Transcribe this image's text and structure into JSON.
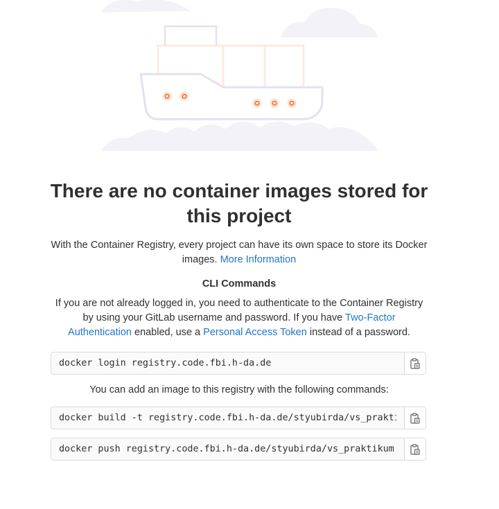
{
  "empty_state": {
    "title": "There are no container images stored for this project",
    "description": "With the Container Registry, every project can have its own space to store its Docker images.",
    "more_info_link": "More Information",
    "cli_heading": "CLI Commands",
    "login_text_1": "If you are not already logged in, you need to authenticate to the Container Registry by using your GitLab username and password. If you have",
    "two_factor_link": "Two-Factor Authentication",
    "login_text_2": "enabled, use a",
    "pat_link": "Personal Access Token",
    "login_text_3": "instead of a password.",
    "add_image_text": "You can add an image to this registry with the following commands:"
  },
  "commands": {
    "login": "docker login registry.code.fbi.h-da.de",
    "build": "docker build -t registry.code.fbi.h-da.de/styubirda/vs_praktikum .",
    "push": "docker push registry.code.fbi.h-da.de/styubirda/vs_praktikum"
  },
  "icons": {
    "copy": "clipboard-icon",
    "illustration": "container-ship-illustration"
  },
  "colors": {
    "link": "#1f75cb",
    "text": "#303030",
    "accent_orange": "#fc6d26"
  }
}
